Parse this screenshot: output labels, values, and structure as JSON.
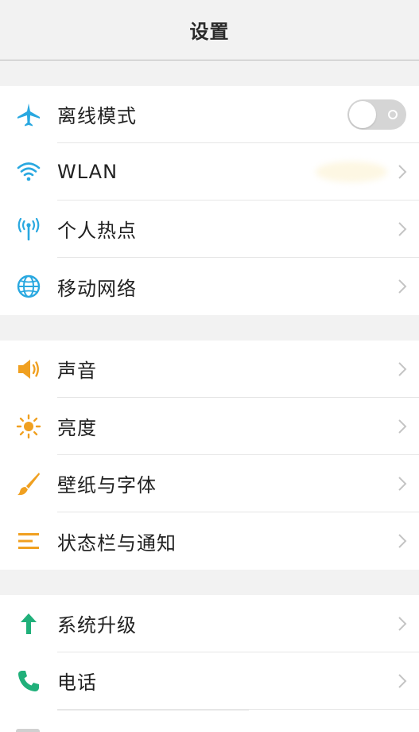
{
  "header": {
    "title": "设置"
  },
  "group1": [
    {
      "label": "离线模式",
      "icon": "airplane-icon",
      "color": "#29a8e0",
      "control": "toggle",
      "toggle_state": "off"
    },
    {
      "label": "WLAN",
      "icon": "wifi-icon",
      "color": "#29a8e0",
      "control": "chevron"
    },
    {
      "label": "个人热点",
      "icon": "hotspot-icon",
      "color": "#29a8e0",
      "control": "chevron"
    },
    {
      "label": "移动网络",
      "icon": "globe-icon",
      "color": "#29a8e0",
      "control": "chevron"
    }
  ],
  "group2": [
    {
      "label": "声音",
      "icon": "speaker-icon",
      "color": "#f0a020",
      "control": "chevron"
    },
    {
      "label": "亮度",
      "icon": "sun-icon",
      "color": "#f0a020",
      "control": "chevron"
    },
    {
      "label": "壁纸与字体",
      "icon": "brush-icon",
      "color": "#f0a020",
      "control": "chevron"
    },
    {
      "label": "状态栏与通知",
      "icon": "menu-lines-icon",
      "color": "#f0a020",
      "control": "chevron"
    }
  ],
  "group3": [
    {
      "label": "系统升级",
      "icon": "arrow-up-icon",
      "color": "#20b07a",
      "control": "chevron"
    },
    {
      "label": "电话",
      "icon": "phone-icon",
      "color": "#20b07a",
      "control": "chevron"
    }
  ],
  "colors": {
    "chevron": "#c4c4c4",
    "toggle_off": "#d5d5d5"
  }
}
